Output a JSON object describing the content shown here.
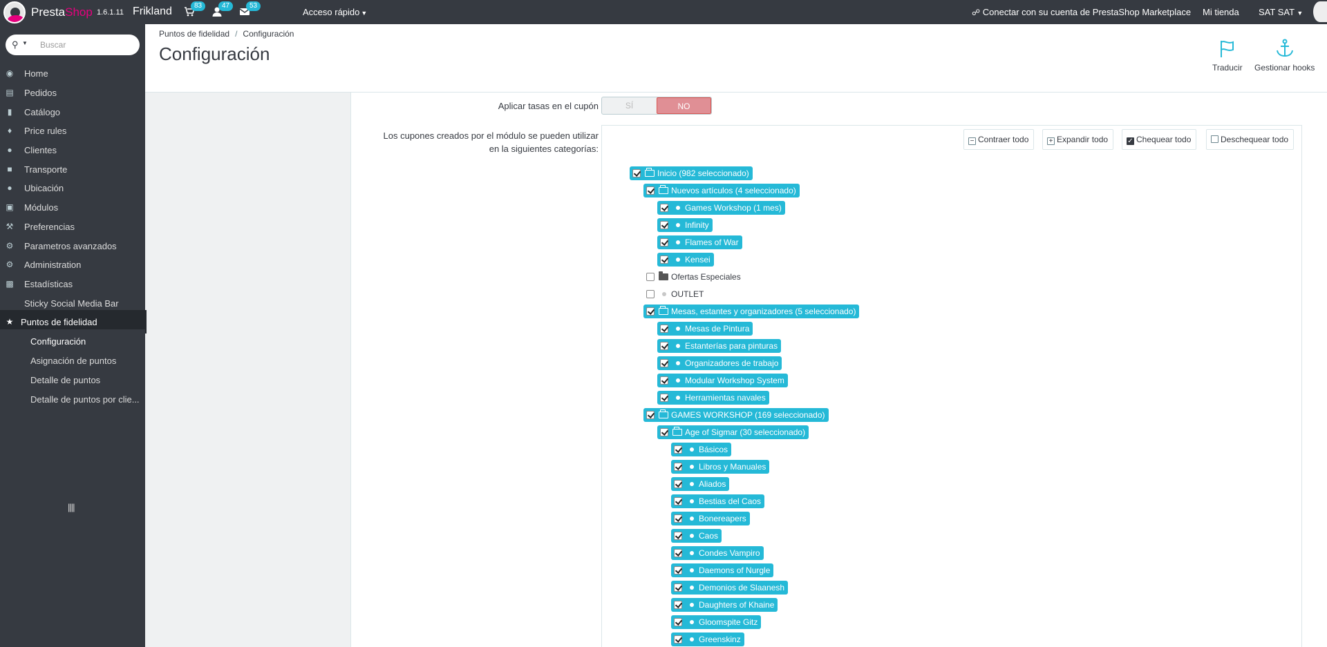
{
  "header": {
    "brand_presta": "Presta",
    "brand_shop": "Shop",
    "version": "1.6.1.11",
    "shop_name": "Frikland",
    "notifications": {
      "orders": "83",
      "customers": "47",
      "messages": "53"
    },
    "quick_access": "Acceso rápido",
    "marketplace": "Conectar con su cuenta de PrestaShop Marketplace",
    "my_shop": "Mi tienda",
    "user": "SAT SAT"
  },
  "sidebar": {
    "search_placeholder": "Buscar",
    "items": [
      {
        "label": "Home",
        "icon": "dashboard-icon"
      },
      {
        "label": "Pedidos",
        "icon": "credit-card-icon"
      },
      {
        "label": "Catálogo",
        "icon": "book-icon"
      },
      {
        "label": "Price rules",
        "icon": "tag-icon"
      },
      {
        "label": "Clientes",
        "icon": "users-icon"
      },
      {
        "label": "Transporte",
        "icon": "truck-icon"
      },
      {
        "label": "Ubicación",
        "icon": "globe-icon"
      },
      {
        "label": "Módulos",
        "icon": "puzzle-icon"
      },
      {
        "label": "Preferencias",
        "icon": "wrench-icon"
      },
      {
        "label": "Parametros avanzados",
        "icon": "cogs-icon"
      },
      {
        "label": "Administration",
        "icon": "cog-icon"
      },
      {
        "label": "Estadísticas",
        "icon": "bar-chart-icon"
      },
      {
        "label": "Sticky Social Media Bar",
        "icon": ""
      },
      {
        "label": "Puntos de fidelidad",
        "icon": "trophy-icon"
      }
    ],
    "subitems": [
      {
        "label": "Configuración"
      },
      {
        "label": "Asignación de puntos"
      },
      {
        "label": "Detalle de puntos"
      },
      {
        "label": "Detalle de puntos por clie..."
      }
    ],
    "collapse_glyph": "||||"
  },
  "page": {
    "breadcrumb": [
      "Puntos de fidelidad",
      "Configuración"
    ],
    "breadcrumb_sep": "/",
    "title": "Configuración",
    "toolbar": {
      "translate": "Traducir",
      "hooks": "Gestionar hooks"
    }
  },
  "form": {
    "tax_label": "Aplicar tasas en el cupón",
    "switch_yes": "SÍ",
    "switch_no": "NO",
    "switch_value": "NO",
    "categories_label_1": "Los cupones creados por el módulo se pueden utilizar",
    "categories_label_2": "en la siguientes categorías:",
    "tree_buttons": {
      "collapse": "Contraer todo",
      "expand": "Expandir todo",
      "check": "Chequear todo",
      "uncheck": "Deschequear todo"
    },
    "tree": [
      {
        "label": "Inicio (982 seleccionado)",
        "level": 0,
        "checked": true,
        "type": "folder-open"
      },
      {
        "label": "Nuevos artículos (4 seleccionado)",
        "level": 1,
        "checked": true,
        "type": "folder-open"
      },
      {
        "label": "Games Workshop (1 mes)",
        "level": 2,
        "checked": true,
        "type": "leaf"
      },
      {
        "label": "Infinity",
        "level": 2,
        "checked": true,
        "type": "leaf"
      },
      {
        "label": "Flames of War",
        "level": 2,
        "checked": true,
        "type": "leaf"
      },
      {
        "label": "Kensei",
        "level": 2,
        "checked": true,
        "type": "leaf"
      },
      {
        "label": "Ofertas Especiales",
        "level": 1,
        "checked": false,
        "type": "folder-closed"
      },
      {
        "label": "OUTLET",
        "level": 1,
        "checked": false,
        "type": "leaf"
      },
      {
        "label": "Mesas, estantes y organizadores (5 seleccionado)",
        "level": 1,
        "checked": true,
        "type": "folder-open"
      },
      {
        "label": "Mesas de Pintura",
        "level": 2,
        "checked": true,
        "type": "leaf"
      },
      {
        "label": "Estanterías para pinturas",
        "level": 2,
        "checked": true,
        "type": "leaf"
      },
      {
        "label": "Organizadores de trabajo",
        "level": 2,
        "checked": true,
        "type": "leaf"
      },
      {
        "label": "Modular Workshop System",
        "level": 2,
        "checked": true,
        "type": "leaf"
      },
      {
        "label": "Herramientas navales",
        "level": 2,
        "checked": true,
        "type": "leaf"
      },
      {
        "label": "GAMES WORKSHOP (169 seleccionado)",
        "level": 1,
        "checked": true,
        "type": "folder-open"
      },
      {
        "label": "Age of Sigmar (30 seleccionado)",
        "level": 2,
        "checked": true,
        "type": "folder-open"
      },
      {
        "label": "Básicos",
        "level": 3,
        "checked": true,
        "type": "leaf"
      },
      {
        "label": "Libros y Manuales",
        "level": 3,
        "checked": true,
        "type": "leaf"
      },
      {
        "label": "Aliados",
        "level": 3,
        "checked": true,
        "type": "leaf"
      },
      {
        "label": "Bestias del Caos",
        "level": 3,
        "checked": true,
        "type": "leaf"
      },
      {
        "label": "Bonereapers",
        "level": 3,
        "checked": true,
        "type": "leaf"
      },
      {
        "label": "Caos",
        "level": 3,
        "checked": true,
        "type": "leaf"
      },
      {
        "label": "Condes Vampiro",
        "level": 3,
        "checked": true,
        "type": "leaf"
      },
      {
        "label": "Daemons of Nurgle",
        "level": 3,
        "checked": true,
        "type": "leaf"
      },
      {
        "label": "Demonios de Slaanesh",
        "level": 3,
        "checked": true,
        "type": "leaf"
      },
      {
        "label": "Daughters of Khaine",
        "level": 3,
        "checked": true,
        "type": "leaf"
      },
      {
        "label": "Gloomspite Gitz",
        "level": 3,
        "checked": true,
        "type": "leaf"
      },
      {
        "label": "Greenskinz",
        "level": 3,
        "checked": true,
        "type": "leaf"
      }
    ]
  },
  "colors": {
    "accent": "#25b9d7",
    "sidebar": "#363a41",
    "switch_off": "#e08f95",
    "brand_pink": "#e6007e"
  }
}
